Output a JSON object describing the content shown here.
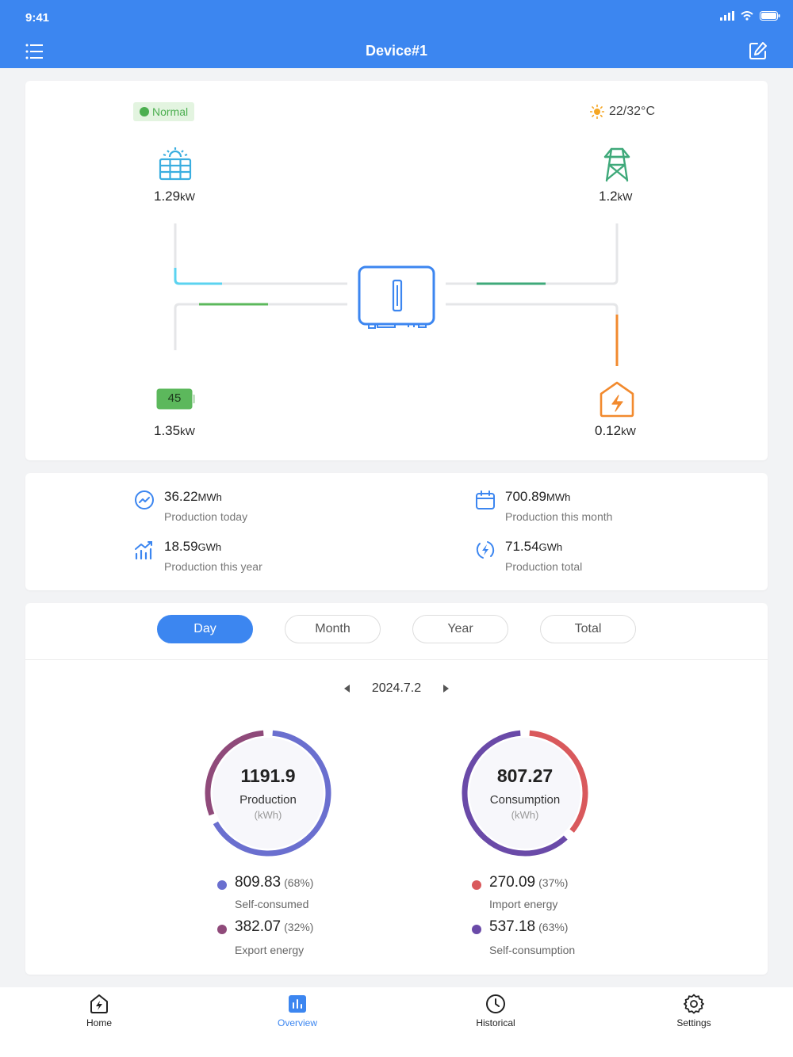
{
  "status_bar": {
    "time": "9:41"
  },
  "header": {
    "title": "Device#1"
  },
  "flow": {
    "status_badge": "Normal",
    "weather": "22/32°C",
    "solar": {
      "value": "1.29",
      "unit": "kW"
    },
    "grid": {
      "value": "1.2",
      "unit": "kW"
    },
    "battery": {
      "level": "45",
      "value": "1.35",
      "unit": "kW"
    },
    "home": {
      "value": "0.12",
      "unit": "kW"
    },
    "colors": {
      "solar": "#5bd3f0",
      "battery": "#5cb85c",
      "grid": "#3fa97a",
      "home": "#f28a2e",
      "inverter": "#3c86f0"
    }
  },
  "stats": [
    {
      "value": "36.22",
      "unit": "MWh",
      "label": "Production today",
      "icon": "trend-icon"
    },
    {
      "value": "700.89",
      "unit": "MWh",
      "label": "Production this month",
      "icon": "calendar-icon"
    },
    {
      "value": "18.59",
      "unit": "GWh",
      "label": "Production this year",
      "icon": "bar-growth-icon"
    },
    {
      "value": "71.54",
      "unit": "GWh",
      "label": "Production total",
      "icon": "bolt-cycle-icon"
    }
  ],
  "energy": {
    "tabs": [
      "Day",
      "Month",
      "Year",
      "Total"
    ],
    "active_tab": "Day",
    "date": "2024.7.2",
    "production": {
      "total": "1191.9",
      "label": "Production",
      "unit": "(kWh)",
      "items": [
        {
          "value": "809.83",
          "pct": "(68%)",
          "label": "Self-consumed",
          "fraction": 0.68,
          "color": "#6a6fcf"
        },
        {
          "value": "382.07",
          "pct": "(32%)",
          "label": "Export energy",
          "fraction": 0.32,
          "color": "#8f4a7a"
        }
      ]
    },
    "consumption": {
      "total": "807.27",
      "label": "Consumption",
      "unit": "(kWh)",
      "items": [
        {
          "value": "270.09",
          "pct": "(37%)",
          "label": "Import energy",
          "fraction": 0.37,
          "color": "#d9595c"
        },
        {
          "value": "537.18",
          "pct": "(63%)",
          "label": "Self-consumption",
          "fraction": 0.63,
          "color": "#6a4aa8"
        }
      ]
    }
  },
  "tabbar": [
    {
      "label": "Home",
      "icon": "home-bolt-icon"
    },
    {
      "label": "Overview",
      "icon": "overview-icon"
    },
    {
      "label": "Historical",
      "icon": "clock-icon"
    },
    {
      "label": "Settings",
      "icon": "gear-icon"
    }
  ],
  "tabbar_active": "Overview"
}
